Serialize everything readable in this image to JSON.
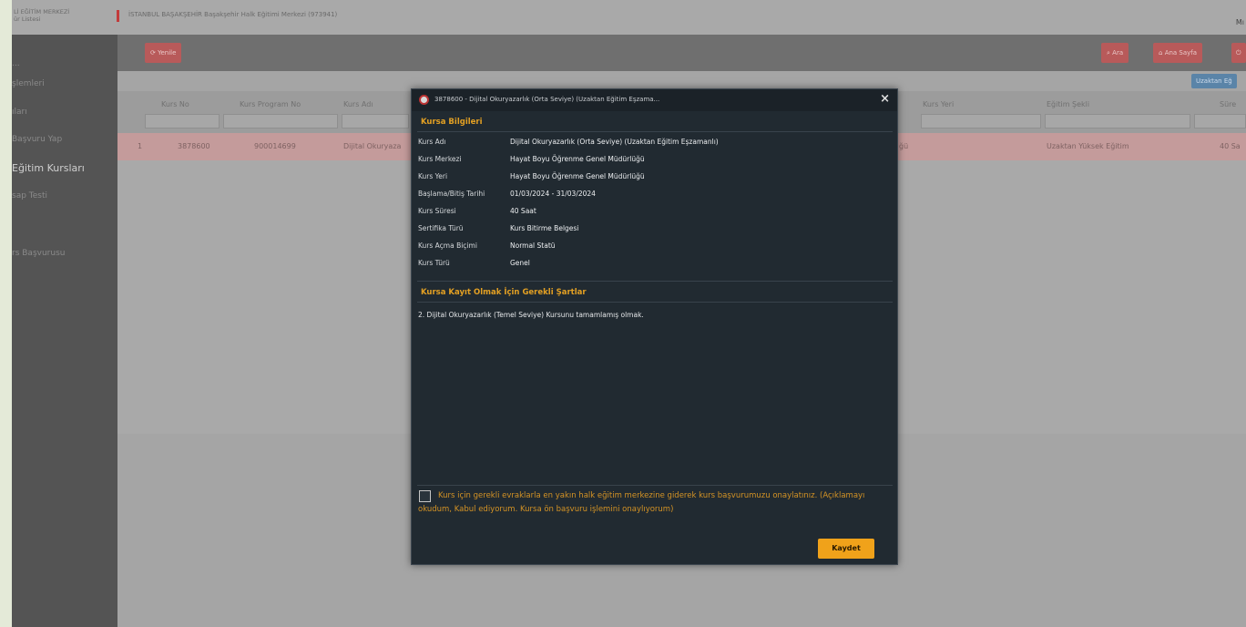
{
  "header": {
    "logo_lines": [
      "Lİ EĞİTİM MERKEZİ",
      "ür Listesi"
    ],
    "title": "İSTANBUL BAŞAKŞEHİR Başakşehir Halk Eğitimi Merkezi (973941)",
    "user": "Mı"
  },
  "sidebar": {
    "items": [
      {
        "label": "..."
      },
      {
        "label": "şlemleri"
      },
      {
        "label": "ıları"
      },
      {
        "label": "Başvuru Yap"
      },
      {
        "label": "Eğitim Kursları"
      },
      {
        "label": "sap Testi"
      },
      {
        "label": "rs Başvurusu"
      }
    ]
  },
  "toolbar": {
    "refresh_label": "Yenile",
    "search_label": "Ara",
    "home_label": "Ana Sayfa",
    "distance_label": "Uzaktan Eğ"
  },
  "grid": {
    "columns": [
      "Kurs No",
      "Kurs Program No",
      "Kurs Adı",
      "Kurs Yeri",
      "Eğitim Şekli",
      "Süre"
    ],
    "row": {
      "index": "1",
      "kurs_no": "3878600",
      "program_no": "900014699",
      "kurs_adi": "Dijital Okuryaza",
      "kurs_yeri_fragment": "ğü",
      "egitim_sekli": "Uzaktan Yüksek Eğitim",
      "sure": "40 Sa"
    }
  },
  "modal": {
    "title": "3878600 - Dijital Okuryazarlık (Orta Seviye) (Uzaktan Eğitim Eşzama...",
    "close": "×",
    "section_info": "Kursa Bilgileri",
    "fields": [
      {
        "label": "Kurs Adı",
        "value": "Dijital Okuryazarlık (Orta Seviye) (Uzaktan Eğitim Eşzamanlı)"
      },
      {
        "label": "Kurs Merkezi",
        "value": "Hayat Boyu Öğrenme Genel Müdürlüğü"
      },
      {
        "label": "Kurs Yeri",
        "value": "Hayat Boyu Öğrenme Genel Müdürlüğü"
      },
      {
        "label": "Başlama/Bitiş Tarihi",
        "value": "01/03/2024 - 31/03/2024"
      },
      {
        "label": "Kurs Süresi",
        "value": "40 Saat"
      },
      {
        "label": "Sertifika Türü",
        "value": "Kurs Bitirme Belgesi"
      },
      {
        "label": "Kurs Açma Biçimi",
        "value": "Normal Statü"
      },
      {
        "label": "Kurs Türü",
        "value": "Genel"
      }
    ],
    "section_requirements": "Kursa Kayıt Olmak İçin Gerekli Şartlar",
    "requirement": "2. Dijital Okuryazarlık (Temel Seviye) Kursunu tamamlamış olmak.",
    "consent": "Kurs için gerekli evraklarla en yakın halk eğitim merkezine giderek kurs başvurumuzu onaylatınız. (Açıklamayı okudum, Kabul ediyorum. Kursa ön başvuru işlemini onaylıyorum)",
    "save_label": "Kaydet"
  },
  "colors": {
    "modal_bg": "#212a31",
    "accent": "#f0a21a",
    "toolbar_red": "#b85a5a"
  }
}
